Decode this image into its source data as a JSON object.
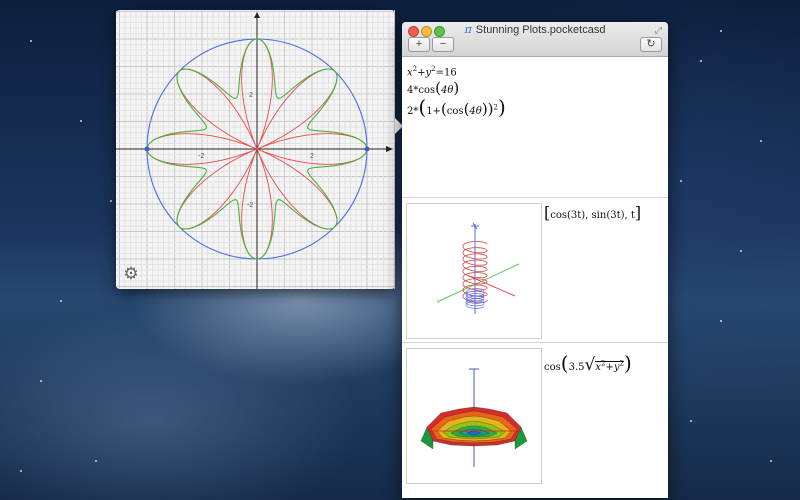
{
  "window": {
    "title": "Stunning Plots.pocketcasd",
    "title_glyph": "π",
    "add_label": "+",
    "remove_label": "−",
    "refresh_label": "↻",
    "fullscreen_glyph": "⤢"
  },
  "popover": {
    "gear_glyph": "⚙",
    "axis_ticks": {
      "x_neg": "-2",
      "x_pos": "2",
      "y_pos": "2",
      "y_neg": "-2"
    }
  },
  "expressions": {
    "e1_lhs": "x",
    "e1_exp1": "2",
    "e1_mid": "+y",
    "e1_exp2": "2",
    "e1_rhs": "=16",
    "e2_prefix": "4*cos",
    "e2_arg": "4θ",
    "e3_prefix": "2*",
    "e3_inner": "1+",
    "e3_cos": "cos",
    "e3_arg": "4θ",
    "e3_exp": "2",
    "e4_text": "cos(3t), sin(3t), t",
    "e5_prefix": "cos",
    "e5_coef": "3.5",
    "e5_x": "x",
    "e5_exp1": "2",
    "e5_plus": "+y",
    "e5_exp2": "2"
  },
  "colors": {
    "circle": "#4a6ee8",
    "rose": "#e84a4a",
    "flower": "#4caf3c",
    "grid": "#d4d4d4"
  }
}
